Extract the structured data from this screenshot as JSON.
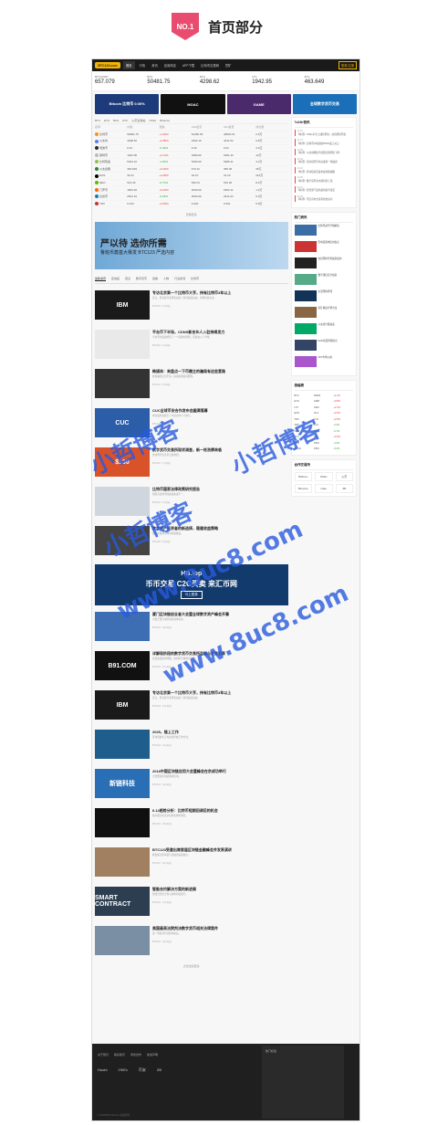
{
  "header": {
    "badge": "NO.1",
    "title": "首页部分"
  },
  "topnav": {
    "logo": "BTC123.com",
    "items": [
      "首页",
      "行情",
      "资讯",
      "应用商店",
      "APP下载",
      "比特币交易网",
      "挖矿"
    ],
    "login": "登录/注册"
  },
  "tickers": [
    {
      "name": "BTC/USDT",
      "price": "657.079"
    },
    {
      "name": "BTC",
      "price": "50481.75"
    },
    {
      "name": "ETH",
      "price": "4298.62"
    },
    {
      "name": "LTC",
      "price": "1942.95"
    },
    {
      "name": "ETC",
      "price": "463.649"
    }
  ],
  "banners": [
    "Bitcoin 比特币 0.06%",
    "MOAC",
    "GAME",
    "全球数字货币交易"
  ],
  "market": {
    "tabs": [
      "BTC",
      "ETH",
      "BCH",
      "ETC",
      "火币全球站",
      "OKEx",
      "Binance"
    ],
    "headers": [
      "名称",
      "价格",
      "涨跌",
      "24H最高",
      "24H最低",
      "成交量"
    ],
    "rows": [
      [
        "比特币",
        "50481.75",
        "+1.20%",
        "51282.05",
        "49520.31",
        "2.6万"
      ],
      [
        "以太坊",
        "4298.62",
        "+0.85%",
        "4352.10",
        "4211.02",
        "9.8万"
      ],
      [
        "瑞波币",
        "6.12",
        "-0.43%",
        "6.30",
        "6.01",
        "3.1亿"
      ],
      [
        "莱特币",
        "1942.95",
        "+2.11%",
        "1980.00",
        "1891.42",
        "12万"
      ],
      [
        "比特现金",
        "5324.10",
        "-1.02%",
        "5450.00",
        "5289.11",
        "3.2万"
      ],
      [
        "以太经典",
        "463.649",
        "+0.62%",
        "470.12",
        "455.30",
        "45万"
      ],
      [
        "EOS",
        "32.41",
        "+3.05%",
        "33.10",
        "31.20",
        "210万"
      ],
      [
        "NEO",
        "521.30",
        "-0.71%",
        "530.01",
        "515.20",
        "8.4万"
      ],
      [
        "门罗币",
        "1823.40",
        "+0.34%",
        "1840.00",
        "1802.11",
        "1.2万"
      ],
      [
        "达世币",
        "2531.10",
        "-0.18%",
        "2560.00",
        "2511.03",
        "0.9万"
      ],
      [
        "TRX",
        "0.312",
        "+4.52%",
        "0.320",
        "0.301",
        "5.6亿"
      ]
    ],
    "more": "查看更多"
  },
  "ad_big": {
    "line1": "严以待 选你所需",
    "line2": "鲁班币奠基大赛发 BTC123 严选内容"
  },
  "news_tabs": [
    "最新资讯",
    "区块链",
    "观点",
    "数字货币",
    "政策",
    "人物",
    "行业新闻",
    "比特币"
  ],
  "news": [
    {
      "title": "专访北京第一个比特币大亨，持有比特币3年以上",
      "desc": "近日，区块链行业再次迎来了新的发展动态，市场持续关注。",
      "meta": "BTC123 · 3小时前",
      "thumb": "IBM",
      "color": "#1a1a1a"
    },
    {
      "title": "平台币下半场，CDNS新合伙人入驻持续发力",
      "desc": "平台币的发展经历了一个完整的周期，目前进入下半场。",
      "meta": "BTC123 · 4小时前",
      "thumb": "",
      "color": "#e9e9e9"
    },
    {
      "title": "韩媒体：来盘点一下币圈主的骗局有这些套路",
      "desc": "各类骗局层出不穷，投资者需提高警惕。",
      "meta": "BTC123 · 5小时前",
      "thumb": "",
      "color": "#333"
    },
    {
      "title": "CUC全球币安合作发布会圆满落幕",
      "desc": "本次发布会吸引了众多业内人士参与。",
      "meta": "BTC123 · 6小时前",
      "thumb": "CUC",
      "color": "#2b5da8"
    },
    {
      "title": "数字货币交易所现状调查，新一轮洗牌来临",
      "desc": "交易所行业竞争日趋激烈。",
      "meta": "BTC123 · 7小时前",
      "thumb": "$100",
      "color": "#d9532a"
    },
    {
      "title": "比特币国家法律政策研究报告",
      "desc": "各国对比特币的政策态度不一。",
      "meta": "BTC123 · 8小时前",
      "thumb": "",
      "color": "#cfd6dd"
    },
    {
      "title": "数字资产投资者的新选择，稳健收益策略",
      "desc": "如何在波动市场中获取收益。",
      "meta": "BTC123 · 9小时前",
      "thumb": "",
      "color": "#444"
    },
    {
      "title": "厦门区块链创业者大会暨全球数字资产峰会开幕",
      "desc": "大会汇聚全球区块链领域专家。",
      "meta": "BTC123 · 10小时前",
      "thumb": "",
      "color": "#3d6db3"
    },
    {
      "title": "详解现阶段的数字货币交易所监管与发展前景",
      "desc": "监管政策逐步明确，交易所合规成为趋势。",
      "meta": "BTC123 · 11小时前",
      "thumb": "B91.COM",
      "color": "#111"
    },
    {
      "title": "专访北京第一个比特币大亨，持有比特币3年以上",
      "desc": "近日，区块链行业再次迎来了新的发展动态。",
      "meta": "BTC123 · 12小时前",
      "thumb": "IBM",
      "color": "#1a1a1a"
    },
    {
      "title": "2025，链上工作",
      "desc": "区块链技术正在改变传统工作方式。",
      "meta": "BTC123 · 13小时前",
      "thumb": "",
      "color": "#1f5e8c"
    },
    {
      "title": "2018中国区块链应用大会暨峰会在京成功举行",
      "desc": "大会聚焦区块链落地应用。",
      "meta": "BTC123 · 14小时前",
      "thumb": "新链科技",
      "color": "#2a6fb5"
    },
    {
      "title": "6.12趋势分析：比特币短期回调后的机会",
      "desc": "技术面分析显示短期支撑位明显。",
      "meta": "BTC123 · 15小时前",
      "thumb": "",
      "color": "#101010"
    },
    {
      "title": "BTC123受邀出席首届区块链金融峰会并发表演讲",
      "desc": "峰会探讨区块链与金融的深度融合。",
      "meta": "BTC123 · 16小时前",
      "thumb": "",
      "color": "#a08060"
    },
    {
      "title": "智能合约解决方案的新进展",
      "desc": "智能合约安全性与效率持续提升。",
      "meta": "BTC123 · 17小时前",
      "thumb": "SMART CONTRACT",
      "color": "#2c3e50"
    },
    {
      "title": "美国最高法院判决数字货币相关法律案件",
      "desc": "这一判决对行业影响深远。",
      "meta": "BTC123 · 18小时前",
      "thumb": "",
      "color": "#7a8fa3"
    }
  ],
  "ad_strip": {
    "t1": "HB.top",
    "t2": "币币交易 C2C买卖 来汇币网",
    "t3": "马上登录"
  },
  "news_more": "点击加载更多",
  "right": {
    "flash_title": "7x24h快讯",
    "flashes": [
      {
        "time": "11:32",
        "text": "【快讯】OKEx平台上线新币种，交易即将开放"
      },
      {
        "time": "11:15",
        "text": "【快讯】比特币价格突破50000美元关口"
      },
      {
        "time": "10:58",
        "text": "【快讯】以太坊网络手续费出现明显下降"
      },
      {
        "time": "10:40",
        "text": "【快讯】某交易所宣布完成新一轮融资"
      },
      {
        "time": "10:22",
        "text": "【快讯】区块链项目发布最新路线图"
      },
      {
        "time": "10:05",
        "text": "【快讯】数字货币总市值持续上涨"
      },
      {
        "time": "09:47",
        "text": "【快讯】监管部门发布最新指导意见"
      },
      {
        "time": "09:30",
        "text": "【快讯】币安宣布支持新的交易对"
      }
    ],
    "hot_title": "热门资讯",
    "hot": [
      {
        "text": "比特币减半行情解读",
        "c": "#3a6ea5"
      },
      {
        "text": "区块链落地应用盘点",
        "c": "#c33"
      },
      {
        "text": "交易所排行榜最新发布",
        "c": "#222"
      },
      {
        "text": "数字钱包安全指南",
        "c": "#5a8"
      },
      {
        "text": "主流币种周评",
        "c": "#135"
      },
      {
        "text": "挖矿收益计算方法",
        "c": "#864"
      },
      {
        "text": "以太坊升级进度",
        "c": "#0a6"
      },
      {
        "text": "DeFi项目风险提示",
        "c": "#346"
      },
      {
        "text": "NFT市场火热",
        "c": "#a5c"
      }
    ],
    "mk_title": "涨幅榜",
    "mk": [
      [
        "BTC",
        "50481",
        "+1.2%"
      ],
      [
        "ETH",
        "4298",
        "+0.8%"
      ],
      [
        "LTC",
        "1942",
        "+2.1%"
      ],
      [
        "EOS",
        "32.4",
        "+3.0%"
      ],
      [
        "TRX",
        "0.31",
        "+4.5%"
      ],
      [
        "XRP",
        "6.12",
        "-0.4%"
      ],
      [
        "NEO",
        "521",
        "-0.7%"
      ],
      [
        "ETC",
        "463",
        "+0.6%"
      ],
      [
        "BCH",
        "5324",
        "-1.0%"
      ],
      [
        "DASH",
        "2531",
        "-0.2%"
      ]
    ],
    "partner_title": "合作交易所",
    "partners": [
      "Bitfinex",
      "OKEx",
      "火币",
      "Binance",
      "Gate",
      "ZB"
    ]
  },
  "footer": {
    "links": [
      "关于我们",
      "联系我们",
      "商务合作",
      "免责声明"
    ],
    "partners": [
      "Huobi",
      "OKEx",
      "币安",
      "ZB"
    ],
    "copyright": "© 2018 BTC123.com 版权所有",
    "hot": "热门标签"
  },
  "watermark": [
    "小哲博客",
    "www.8uc8.com"
  ]
}
